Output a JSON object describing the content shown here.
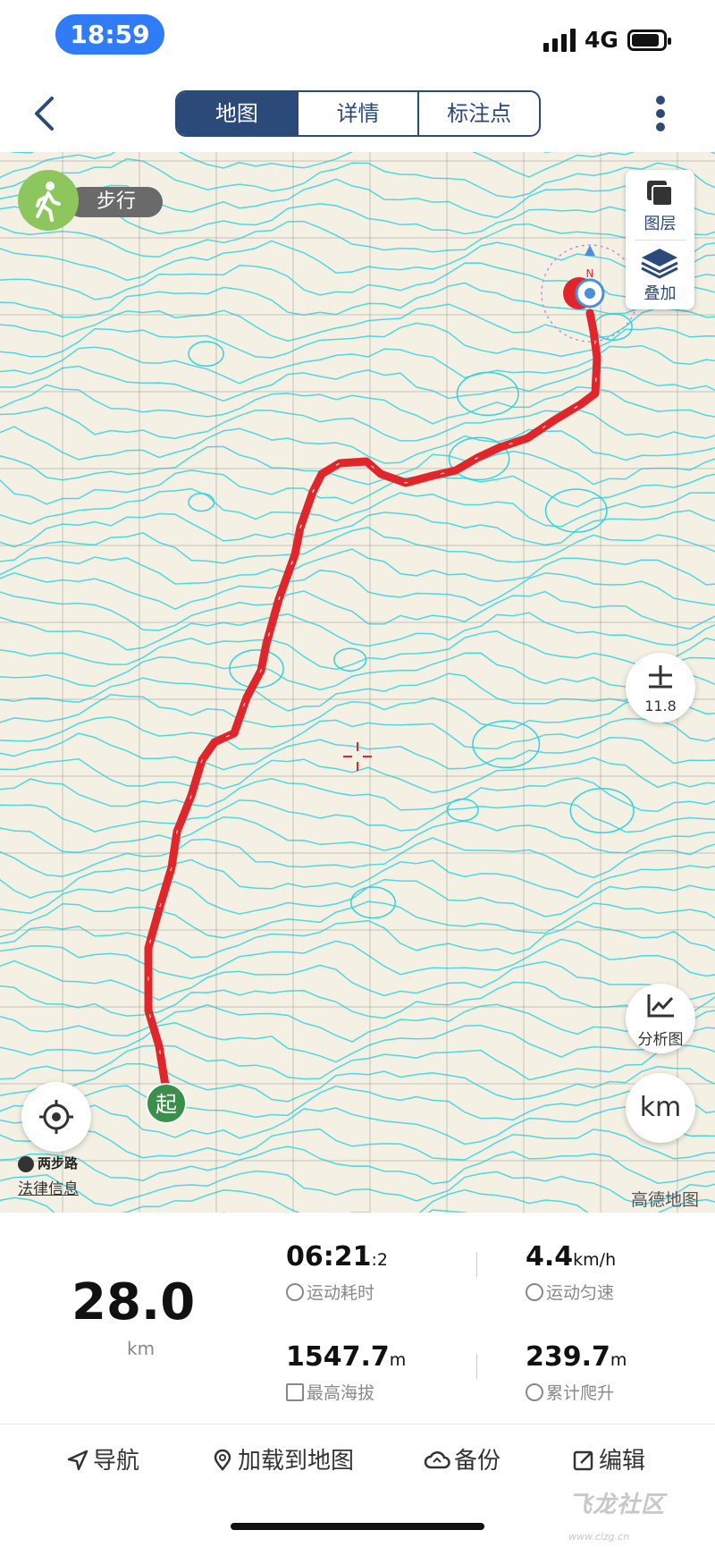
{
  "status_bar": {
    "time": "18:59",
    "network": "4G"
  },
  "nav": {
    "tabs": [
      {
        "label": "地图",
        "active": true
      },
      {
        "label": "详情",
        "active": false
      },
      {
        "label": "标注点",
        "active": false
      }
    ]
  },
  "map": {
    "mode_label": "步行",
    "layer_label": "图层",
    "overlay_label": "叠加",
    "zoom_level": "11.8",
    "chart_label": "分析图",
    "unit_button": "km",
    "road_label": "两步路",
    "legal_link": "法律信息",
    "brand": "高德地图",
    "start_marker": "起",
    "north_label": "N",
    "colors": {
      "track": "#e0262b",
      "contour": "#2fd3e0",
      "grid": "#9a9a9a",
      "start": "#3a8f4a"
    }
  },
  "stats": {
    "distance_value": "28.0",
    "distance_unit": "km",
    "duration": {
      "main": "06:21",
      "sub": ":2",
      "caption": "运动耗时"
    },
    "speed": {
      "value": "4.4",
      "unit": "km/h",
      "caption": "运动匀速"
    },
    "max_altitude": {
      "value": "1547.7",
      "unit": "m",
      "caption": "最高海拔"
    },
    "climb": {
      "value": "239.7",
      "unit": "m",
      "caption": "累计爬升"
    }
  },
  "actions": {
    "navigate": "导航",
    "load_to_map": "加载到地图",
    "backup": "备份",
    "edit": "编辑"
  },
  "watermark": {
    "text": "飞龙社区",
    "domain": "www.clzg.cn"
  }
}
